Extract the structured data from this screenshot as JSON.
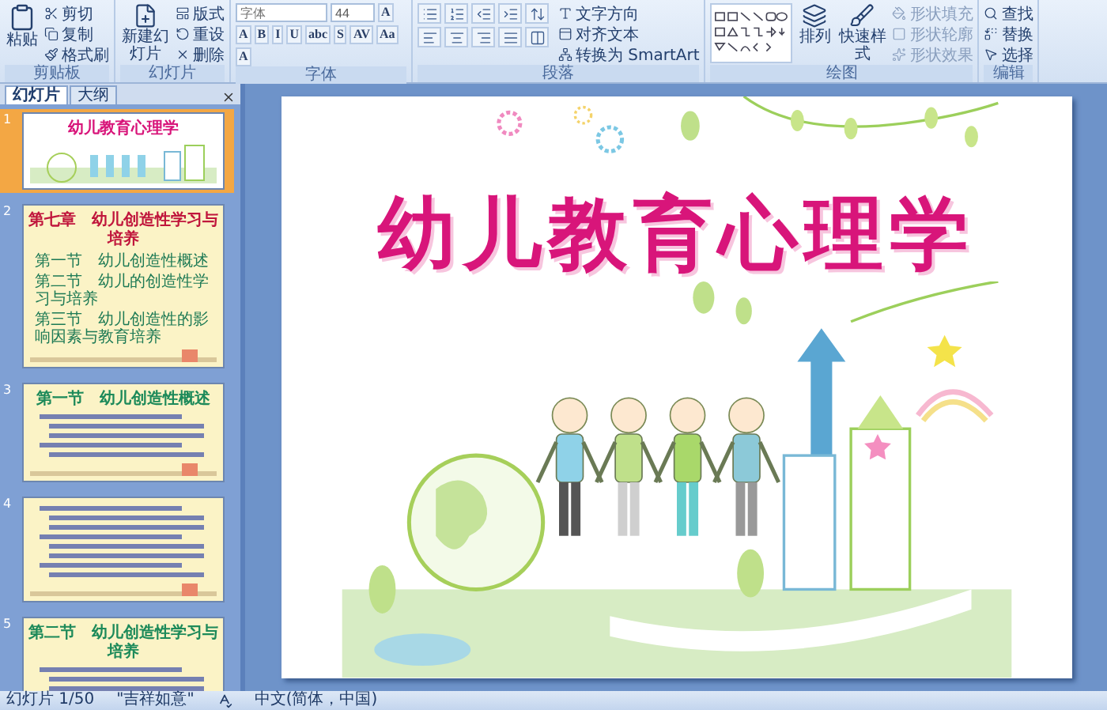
{
  "ribbon": {
    "groups": [
      {
        "label": "剪贴板",
        "items": [
          {
            "kind": "large",
            "label": "粘贴"
          },
          {
            "kind": "small",
            "label": "剪切"
          },
          {
            "kind": "small",
            "label": "复制"
          },
          {
            "kind": "small",
            "label": "格式刷"
          }
        ]
      },
      {
        "label": "幻灯片",
        "items": [
          {
            "kind": "large",
            "label": "新建幻灯片"
          },
          {
            "kind": "small",
            "label": "版式"
          },
          {
            "kind": "small",
            "label": "重设"
          },
          {
            "kind": "small",
            "label": "删除"
          }
        ]
      },
      {
        "label": "字体",
        "items": [
          {
            "kind": "field",
            "placeholder": "字体"
          },
          {
            "kind": "field",
            "value": "44"
          },
          {
            "kind": "glyph",
            "label": "A"
          },
          {
            "kind": "glyph",
            "label": "A"
          },
          {
            "kind": "glyph",
            "label": "B"
          },
          {
            "kind": "glyph",
            "label": "I"
          },
          {
            "kind": "glyph",
            "label": "U"
          },
          {
            "kind": "glyph",
            "label": "abc"
          },
          {
            "kind": "glyph",
            "label": "S"
          },
          {
            "kind": "glyph",
            "label": "AV"
          },
          {
            "kind": "glyph",
            "label": "Aa"
          },
          {
            "kind": "glyph",
            "label": "A"
          }
        ]
      },
      {
        "label": "段落",
        "items": [
          {
            "kind": "icon"
          },
          {
            "kind": "icon"
          },
          {
            "kind": "icon"
          },
          {
            "kind": "icon"
          },
          {
            "kind": "icon"
          },
          {
            "kind": "icon"
          },
          {
            "kind": "icon"
          },
          {
            "kind": "icon"
          },
          {
            "kind": "icon"
          },
          {
            "kind": "icon"
          },
          {
            "kind": "small",
            "label": "文字方向"
          },
          {
            "kind": "small",
            "label": "对齐文本"
          },
          {
            "kind": "small",
            "label": "转换为 SmartArt"
          }
        ]
      },
      {
        "label": "绘图",
        "items": [
          {
            "kind": "gallery"
          },
          {
            "kind": "large",
            "label": "排列"
          },
          {
            "kind": "large",
            "label": "快速样式"
          },
          {
            "kind": "small",
            "label": "形状填充"
          },
          {
            "kind": "small",
            "label": "形状轮廓"
          },
          {
            "kind": "small",
            "label": "形状效果"
          }
        ]
      },
      {
        "label": "编辑",
        "items": [
          {
            "kind": "small",
            "label": "查找"
          },
          {
            "kind": "small",
            "label": "替换"
          },
          {
            "kind": "small",
            "label": "选择"
          }
        ]
      }
    ]
  },
  "pane_tabs": [
    {
      "label": "幻灯片",
      "selected": true
    },
    {
      "label": "大纲",
      "selected": false
    }
  ],
  "thumbnails": [
    {
      "number": "1",
      "selected": true,
      "kind": "cover",
      "title": "幼儿教育心理学"
    },
    {
      "number": "2",
      "selected": false,
      "kind": "contents",
      "title": "第七章　幼儿创造性学习与培养",
      "lines": [
        "第一节　幼儿创造性概述",
        "第二节　幼儿的创造性学习与培养",
        "第三节　幼儿创造性的影响因素与教育培养"
      ]
    },
    {
      "number": "3",
      "selected": false,
      "kind": "text",
      "title": "第一节　幼儿创造性概述"
    },
    {
      "number": "4",
      "selected": false,
      "kind": "text"
    },
    {
      "number": "5",
      "selected": false,
      "kind": "text",
      "title": "第二节　幼儿创造性学习与培养"
    }
  ],
  "slide": {
    "title": "幼儿教育心理学"
  },
  "status_bar": {
    "slide": "幻灯片 1/50",
    "theme": "\"吉祥如意\"",
    "language": "中文(简体，中国)"
  }
}
